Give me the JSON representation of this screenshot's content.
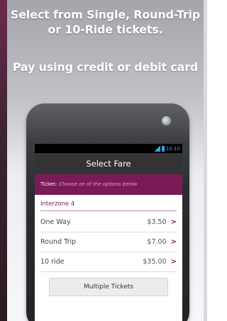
{
  "promo": {
    "headline_line1": "Select from Single, Round-Trip",
    "headline_line2": "or 10-Ride tickets.",
    "headline_line3": "Pay using credit or debit card"
  },
  "status_bar": {
    "time": "10:10"
  },
  "screen": {
    "title": "Select Fare",
    "ticket_label": "Ticket:",
    "ticket_hint": "Choose on of the options below",
    "zone": "Interzone 4",
    "fares": [
      {
        "label": "One Way",
        "price": "$3.50"
      },
      {
        "label": "Round Trip",
        "price": "$7.00"
      },
      {
        "label": "10 ride",
        "price": "$35.00"
      }
    ],
    "multiple_tickets_label": "Multiple Tickets"
  },
  "colors": {
    "accent": "#7a1b57",
    "title_bar": "#333336",
    "status_icons": "#2fa7e0"
  }
}
